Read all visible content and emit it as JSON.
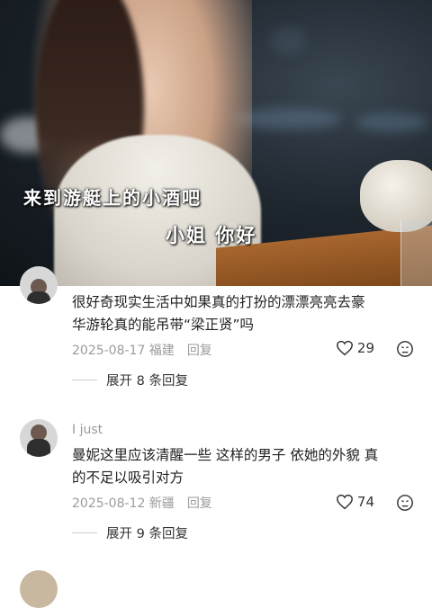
{
  "video": {
    "subtitle_1": "来到游艇上的小酒吧",
    "subtitle_2": "小姐 你好"
  },
  "comments": [
    {
      "username": "",
      "text_line1": "很好奇现实生活中如果真的打扮的漂漂亮亮去豪",
      "text_line2": "华游轮真的能吊带“梁正贤”吗",
      "date_location": "2025-08-17 福建",
      "reply_label": "回复",
      "likes": "29",
      "expand_label": "展开 8 条回复"
    },
    {
      "username": "I just",
      "text_line1": "曼妮这里应该清醒一些 这样的男子 依她的外貌 真",
      "text_line2": "的不足以吸引对方",
      "date_location": "2025-08-12 新疆",
      "reply_label": "回复",
      "likes": "74",
      "expand_label": "展开 9 条回复"
    }
  ]
}
